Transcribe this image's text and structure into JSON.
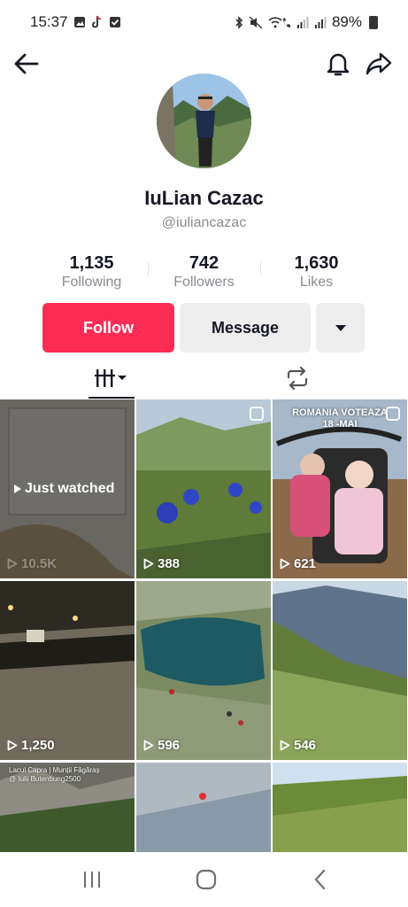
{
  "status_bar": {
    "time": "15:37",
    "battery": "89%",
    "left_icons": [
      "gallery-icon",
      "tiktok-icon",
      "checkbox-icon"
    ],
    "right_icons": [
      "bluetooth-icon",
      "mute-icon",
      "wifi-call-icon",
      "signal-icon",
      "signal-icon",
      "battery-icon"
    ]
  },
  "top_nav": {
    "back_icon": "arrow-left-icon",
    "bell_icon": "bell-icon",
    "share_icon": "share-icon"
  },
  "profile": {
    "display_name": "IuLian Cazac",
    "username": "@iuliancazac"
  },
  "stats": [
    {
      "value": "1,135",
      "label": "Following"
    },
    {
      "value": "742",
      "label": "Followers"
    },
    {
      "value": "1,630",
      "label": "Likes"
    }
  ],
  "actions": {
    "follow_label": "Follow",
    "message_label": "Message",
    "more_icon": "caret-down-icon"
  },
  "colors": {
    "accent": "#fe2c55",
    "button_gray": "#eeeeef",
    "text_primary": "#161823",
    "text_secondary": "#8a8b91"
  },
  "tabs": [
    {
      "name": "videos",
      "icon": "grid-icon",
      "active": true
    },
    {
      "name": "reposts",
      "icon": "repost-icon",
      "active": false
    }
  ],
  "videos": [
    {
      "views": "10.5K",
      "badge": "Just watched",
      "caption": ""
    },
    {
      "views": "388",
      "badge": "",
      "caption": ""
    },
    {
      "views": "621",
      "badge": "",
      "caption": "ROMANIA VOTEAZA\n18 -MAI"
    },
    {
      "views": "1,250",
      "badge": "",
      "caption": ""
    },
    {
      "views": "596",
      "badge": "",
      "caption": ""
    },
    {
      "views": "546",
      "badge": "",
      "caption": ""
    },
    {
      "views": "",
      "badge": "",
      "caption": "Lacul Capra | Munții Făgăraș\n@ Iulii Butenbung2500"
    },
    {
      "views": "",
      "badge": "",
      "caption": ""
    },
    {
      "views": "",
      "badge": "",
      "caption": ""
    }
  ],
  "system_nav": {
    "recent_icon": "recent-apps-icon",
    "home_icon": "home-icon",
    "back_icon": "system-back-icon"
  }
}
